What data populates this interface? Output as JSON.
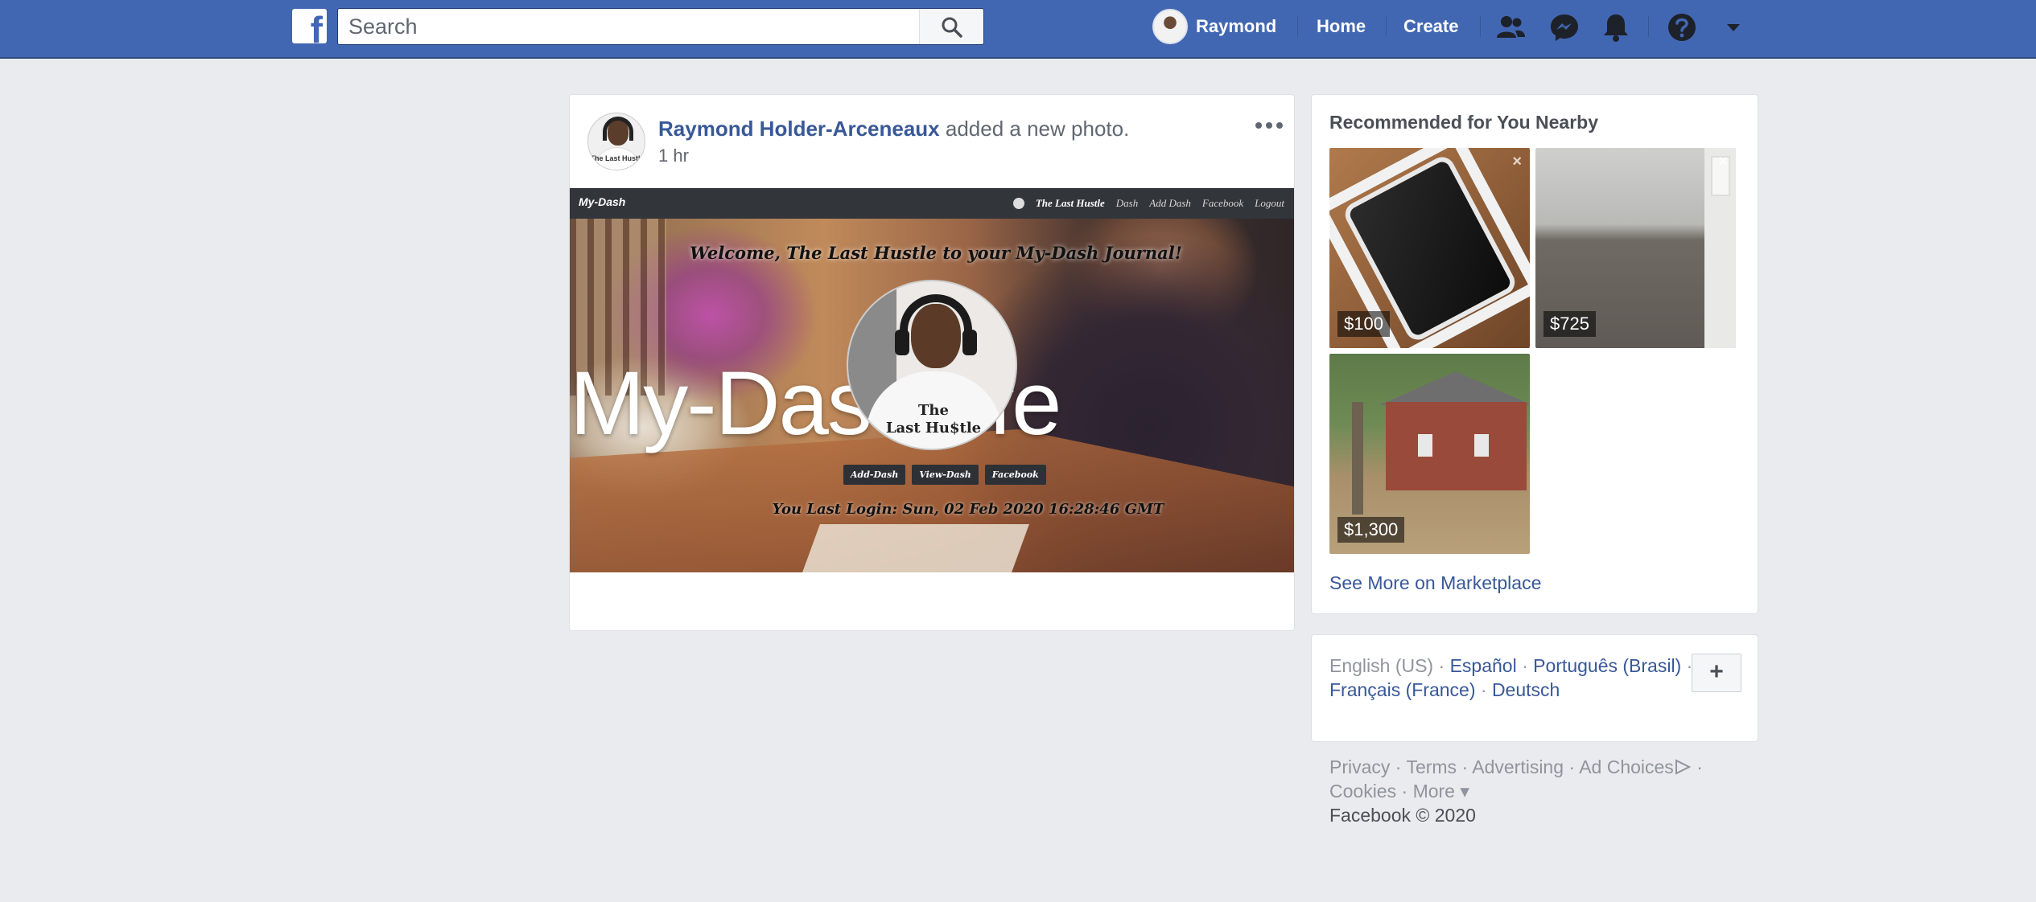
{
  "topbar": {
    "logo": "f",
    "search_placeholder": "Search",
    "user_name": "Raymond",
    "nav_home": "Home",
    "nav_create": "Create",
    "icons": [
      "friend-requests-icon",
      "messenger-icon",
      "notifications-icon",
      "help-icon",
      "account-menu-icon"
    ]
  },
  "post": {
    "author": "Raymond Holder-Arceneaux",
    "action": "added a new photo.",
    "time": "1 hr",
    "avatar_shirt_text": "The Last Hustle",
    "screenshot": {
      "brand": "My-Dash",
      "nav_items": [
        "The Last Hustle",
        "Dash",
        "Add Dash",
        "Facebook",
        "Logout"
      ],
      "welcome": "Welcome, The Last Hustle to your My-Dash Journal!",
      "hero_left": "My-Das",
      "hero_right": "fe",
      "circle_text_line1": "The",
      "circle_text_line2": "Last Hu$tle",
      "buttons": [
        "Add-Dash",
        "View-Dash",
        "Facebook"
      ],
      "last_login": "You Last Login: Sun, 02 Feb 2020 16:28:46 GMT"
    }
  },
  "recommended": {
    "title": "Recommended for You Nearby",
    "items": [
      {
        "price": "$100",
        "kind": "phone"
      },
      {
        "price": "$725",
        "kind": "room"
      },
      {
        "price": "$1,300",
        "kind": "house"
      }
    ],
    "see_more": "See More on Marketplace"
  },
  "languages": {
    "current": "English (US)",
    "links": [
      "Español",
      "Português (Brasil)",
      "Français (France)",
      "Deutsch"
    ],
    "add_label": "+"
  },
  "footer": {
    "links": [
      "Privacy",
      "Terms",
      "Advertising",
      "Ad Choices",
      "Cookies",
      "More"
    ],
    "copyright": "Facebook © 2020"
  },
  "colors": {
    "brand_blue": "#4267b2",
    "link_blue": "#385898",
    "page_bg": "#e9ebee"
  }
}
